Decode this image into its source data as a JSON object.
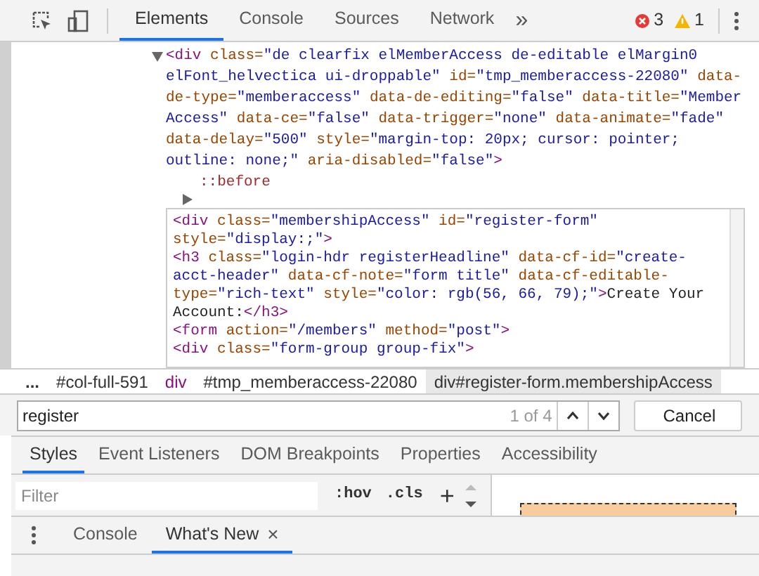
{
  "toolbar": {
    "tabs": [
      {
        "label": "Elements",
        "selected": true
      },
      {
        "label": "Console",
        "selected": false
      },
      {
        "label": "Sources",
        "selected": false
      },
      {
        "label": "Network",
        "selected": false
      }
    ],
    "more": "»",
    "errors": "3",
    "warnings": "1"
  },
  "dom": {
    "lines": [
      [
        {
          "kind": "tag",
          "text": "<div"
        },
        {
          "kind": "attr",
          "text": " class="
        },
        {
          "kind": "value",
          "text": "\"de clearfix elMemberAccess de-editable elMargin0"
        }
      ],
      [
        {
          "kind": "value",
          "text": "elFont_helvectica ui-droppable\""
        },
        {
          "kind": "attr",
          "text": " id="
        },
        {
          "kind": "value",
          "text": "\"tmp_memberaccess-22080\""
        },
        {
          "kind": "attr",
          "text": " data-"
        }
      ],
      [
        {
          "kind": "attr",
          "text": "de-type="
        },
        {
          "kind": "value",
          "text": "\"memberaccess\""
        },
        {
          "kind": "attr",
          "text": " data-de-editing="
        },
        {
          "kind": "value",
          "text": "\"false\""
        },
        {
          "kind": "attr",
          "text": " data-title="
        },
        {
          "kind": "value",
          "text": "\"Member"
        }
      ],
      [
        {
          "kind": "value",
          "text": "Access\""
        },
        {
          "kind": "attr",
          "text": " data-ce="
        },
        {
          "kind": "value",
          "text": "\"false\""
        },
        {
          "kind": "attr",
          "text": " data-trigger="
        },
        {
          "kind": "value",
          "text": "\"none\""
        },
        {
          "kind": "attr",
          "text": " data-animate="
        },
        {
          "kind": "value",
          "text": "\"fade\""
        }
      ],
      [
        {
          "kind": "attr",
          "text": "data-delay="
        },
        {
          "kind": "value",
          "text": "\"500\""
        },
        {
          "kind": "attr",
          "text": " style="
        },
        {
          "kind": "value",
          "text": "\"margin-top: 20px; cursor: pointer;"
        }
      ],
      [
        {
          "kind": "value",
          "text": "outline: none;\""
        },
        {
          "kind": "attr",
          "text": " aria-disabled="
        },
        {
          "kind": "value",
          "text": "\"false\""
        },
        {
          "kind": "tag",
          "text": ">"
        }
      ]
    ],
    "pseudo": "::before"
  },
  "editor": {
    "lines": [
      [
        {
          "kind": "tag",
          "text": "<div"
        },
        {
          "kind": "attr",
          "text": " class="
        },
        {
          "kind": "value",
          "text": "\"membershipAccess\""
        },
        {
          "kind": "attr",
          "text": " id="
        },
        {
          "kind": "value",
          "text": "\"register-form\""
        }
      ],
      [
        {
          "kind": "attr",
          "text": "style="
        },
        {
          "kind": "value",
          "text": "\"display:;\""
        },
        {
          "kind": "tag",
          "text": ">"
        }
      ],
      [
        {
          "kind": "tag",
          "text": "<h3"
        },
        {
          "kind": "attr",
          "text": " class="
        },
        {
          "kind": "value",
          "text": "\"login-hdr registerHeadline\""
        },
        {
          "kind": "attr",
          "text": " data-cf-id="
        },
        {
          "kind": "value",
          "text": "\"create-"
        }
      ],
      [
        {
          "kind": "value",
          "text": "acct-header\""
        },
        {
          "kind": "attr",
          "text": " data-cf-note="
        },
        {
          "kind": "value",
          "text": "\"form title\""
        },
        {
          "kind": "attr",
          "text": " data-cf-editable-"
        }
      ],
      [
        {
          "kind": "attr",
          "text": "type="
        },
        {
          "kind": "value",
          "text": "\"rich-text\""
        },
        {
          "kind": "attr",
          "text": " style="
        },
        {
          "kind": "value",
          "text": "\"color: rgb(56, 66, 79);\""
        },
        {
          "kind": "tag",
          "text": ">"
        },
        {
          "kind": "text",
          "text": "Create Your"
        }
      ],
      [
        {
          "kind": "text",
          "text": "Account:"
        },
        {
          "kind": "tag",
          "text": "</h3>"
        }
      ],
      [
        {
          "kind": "tag",
          "text": "<form"
        },
        {
          "kind": "attr",
          "text": " action="
        },
        {
          "kind": "value",
          "text": "\"/members\""
        },
        {
          "kind": "attr",
          "text": " method="
        },
        {
          "kind": "value",
          "text": "\"post\""
        },
        {
          "kind": "tag",
          "text": ">"
        }
      ],
      [
        {
          "kind": "tag",
          "text": "<div"
        },
        {
          "kind": "attr",
          "text": " class="
        },
        {
          "kind": "value",
          "text": "\"form-group group-fix\""
        },
        {
          "kind": "tag",
          "text": ">"
        }
      ]
    ]
  },
  "breadcrumbs": [
    {
      "text": "...",
      "kind": "more",
      "selected": false
    },
    {
      "text": "#col-full-591",
      "kind": "id",
      "selected": false
    },
    {
      "text": "div",
      "kind": "tag",
      "selected": false
    },
    {
      "text": "#tmp_memberaccess-22080",
      "kind": "id",
      "selected": false
    },
    {
      "text": "div#register-form.membershipAccess",
      "kind": "id",
      "selected": true
    }
  ],
  "search": {
    "value": "register",
    "count": "1 of 4",
    "cancel": "Cancel"
  },
  "subtabs": [
    {
      "label": "Styles",
      "selected": true
    },
    {
      "label": "Event Listeners",
      "selected": false
    },
    {
      "label": "DOM Breakpoints",
      "selected": false
    },
    {
      "label": "Properties",
      "selected": false
    },
    {
      "label": "Accessibility",
      "selected": false
    }
  ],
  "filter": {
    "placeholder": "Filter",
    "hov": ":hov",
    "cls": ".cls",
    "add": "+"
  },
  "drawer": {
    "tabs": [
      {
        "label": "Console",
        "selected": false
      },
      {
        "label": "What's New",
        "selected": true,
        "close": "×"
      }
    ]
  }
}
